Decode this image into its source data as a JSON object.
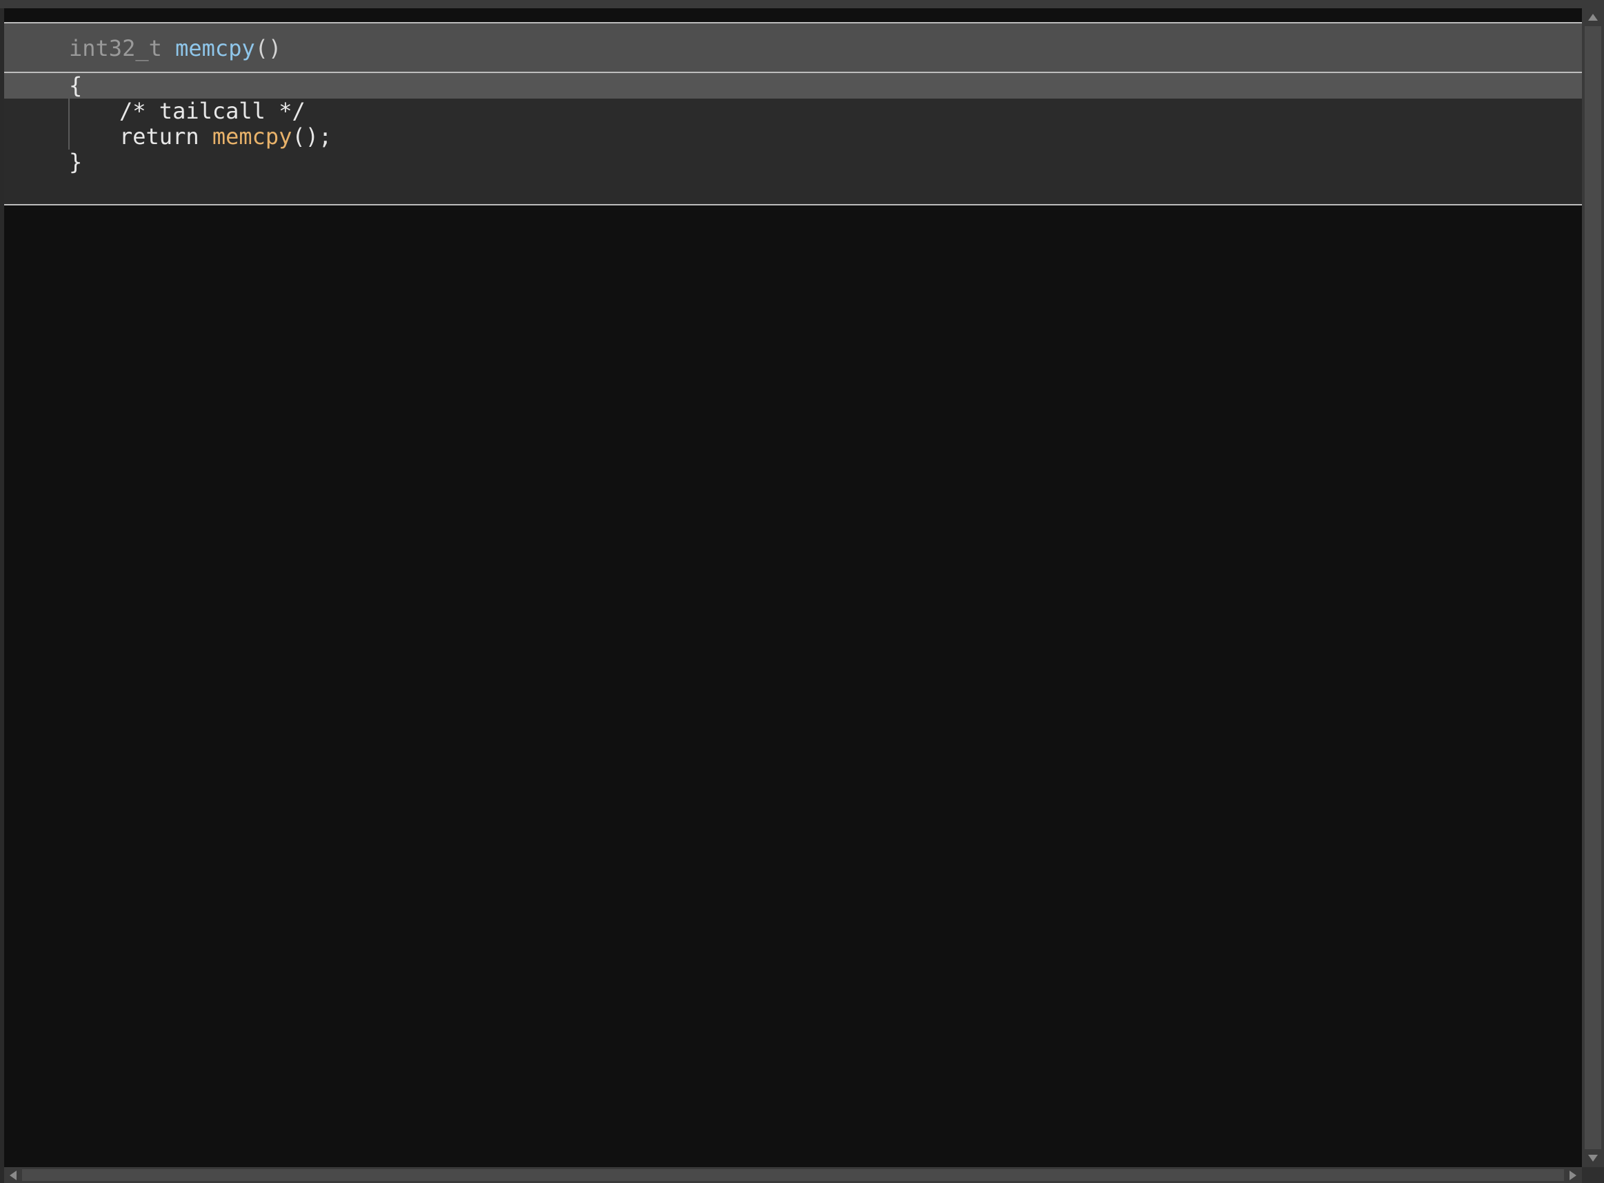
{
  "signature": {
    "return_type": "int32_t",
    "function_name": "memcpy",
    "params": "()"
  },
  "body": {
    "open_brace": "{",
    "comment": "/* tailcall */",
    "return_keyword": "return",
    "called_function": "memcpy",
    "call_suffix": "();",
    "close_brace": "}"
  },
  "colors": {
    "background": "#101010",
    "signature_bg": "#4f4f4f",
    "body_bg": "#2b2b2b",
    "highlight_line": "#555555",
    "type_text": "#9a9a9a",
    "function_decl": "#8fc6ea",
    "function_call": "#e8b26a",
    "text": "#e8e8e8"
  },
  "icons": {
    "scroll_up": "triangle-up-icon",
    "scroll_down": "triangle-down-icon",
    "scroll_left": "triangle-left-icon",
    "scroll_right": "triangle-right-icon"
  }
}
